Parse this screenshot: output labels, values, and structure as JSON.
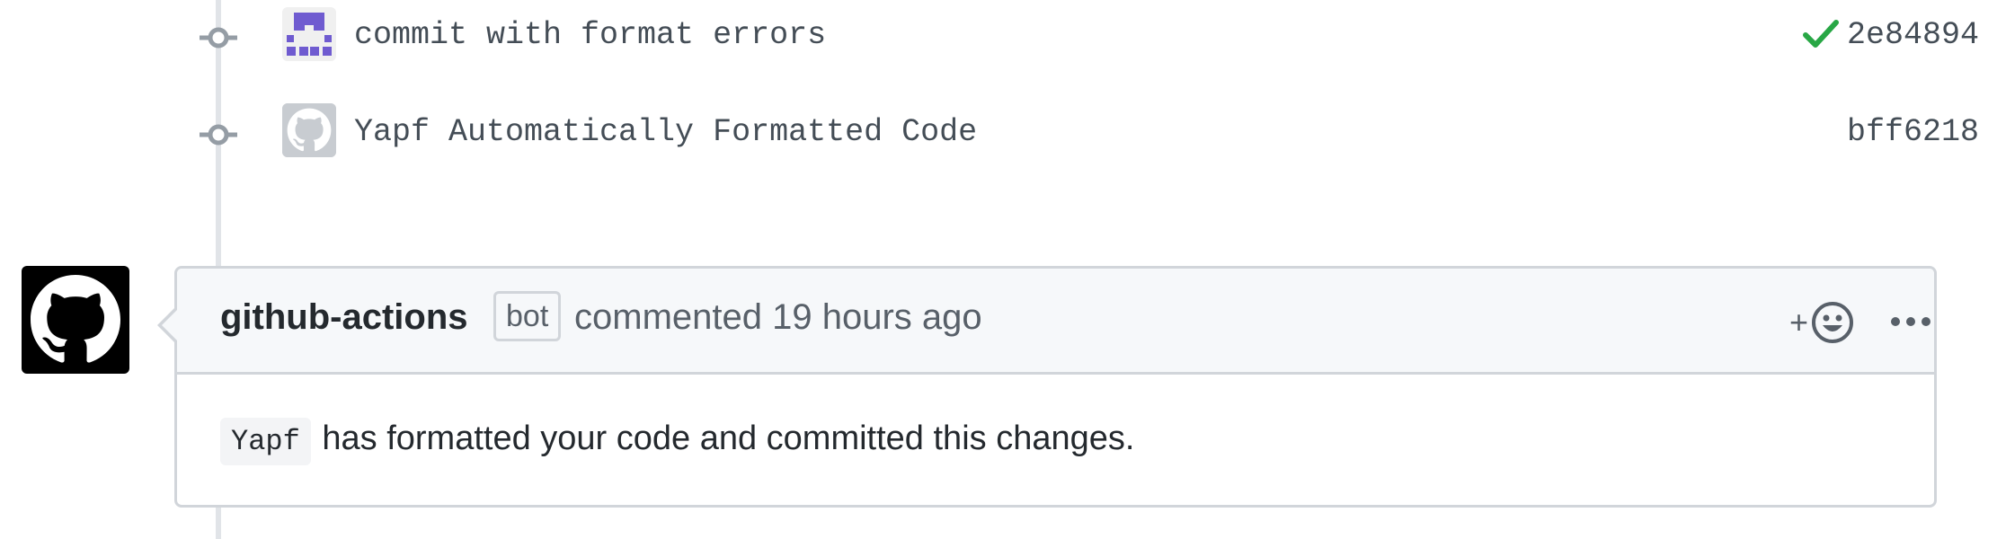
{
  "commits": [
    {
      "message": "commit with format errors",
      "sha": "2e84894",
      "status": "success",
      "avatar": "identicon"
    },
    {
      "message": "Yapf Automatically Formatted Code",
      "sha": "bff6218",
      "status": "none",
      "avatar": "github-octocat"
    }
  ],
  "comment": {
    "author": "github-actions",
    "badge": "bot",
    "meta": "commented 19 hours ago",
    "reaction_plus": "+",
    "body_code": "Yapf",
    "body_text": "has formatted your code and committed this changes."
  },
  "colors": {
    "check": "#28a745",
    "identicon": "#6f5bd0",
    "timeline": "#e1e4e8",
    "header_bg": "#f6f8fa",
    "border": "#d1d5da"
  },
  "icons": {
    "commit_node": "git-commit-icon",
    "status": "check-icon",
    "reaction": "smiley-icon",
    "more": "kebab-horizontal-icon",
    "avatar": "octocat-icon"
  }
}
